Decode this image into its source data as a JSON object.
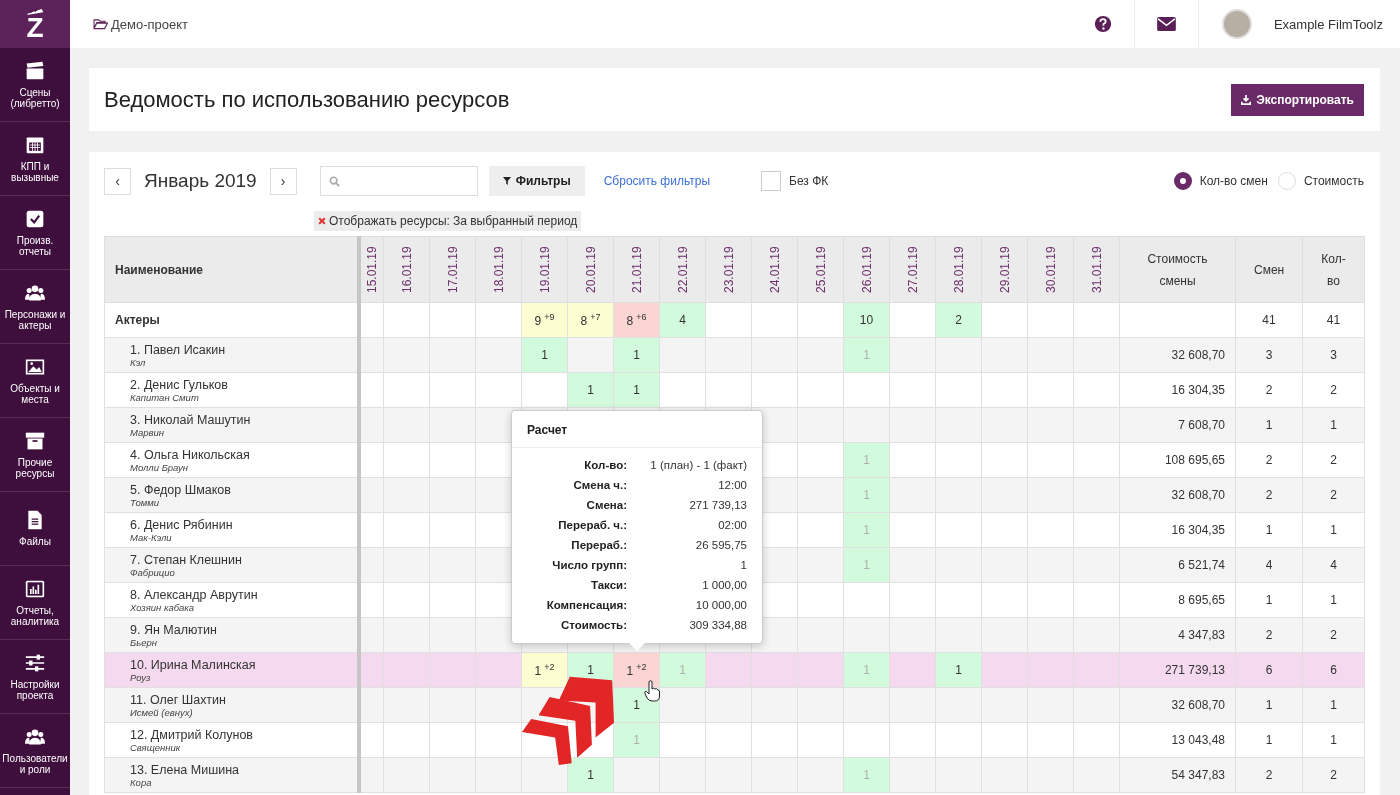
{
  "sidebar": {
    "logo": "Z",
    "items": [
      {
        "label": "Сцены (либретто)"
      },
      {
        "label": "КПП и вызывные"
      },
      {
        "label": "Произв. отчеты"
      },
      {
        "label": "Персонажи и актеры"
      },
      {
        "label": "Объекты и места"
      },
      {
        "label": "Прочие ресурсы"
      },
      {
        "label": "Файлы"
      },
      {
        "label": "Отчеты, аналитика"
      },
      {
        "label": "Настройки проекта"
      },
      {
        "label": "Пользователи и роли"
      }
    ]
  },
  "top_bar": {
    "project": "Демо-проект",
    "user": "Example FilmToolz"
  },
  "page": {
    "title": "Ведомость по использованию ресурсов",
    "export_button": "Экспортировать"
  },
  "toolbar": {
    "prev": "‹",
    "month": "Январь 2019",
    "next": "›",
    "filters_button": "Фильтры",
    "reset_link": "Сбросить фильтры",
    "without_fk": {
      "label": "Без ФК",
      "checked": false
    },
    "modes": [
      {
        "label": "Кол-во смен",
        "selected": true
      },
      {
        "label": "Стоимость",
        "selected": false
      }
    ],
    "active_filter": {
      "label": "Отображать ресурсы:",
      "value": "За выбранный период"
    }
  },
  "table": {
    "name_column": "Наименование",
    "dates": [
      "15.01.19",
      "16.01.19",
      "17.01.19",
      "18.01.19",
      "19.01.19",
      "20.01.19",
      "21.01.19",
      "22.01.19",
      "23.01.19",
      "24.01.19",
      "25.01.19",
      "26.01.19",
      "27.01.19",
      "28.01.19",
      "29.01.19",
      "30.01.19",
      "31.01.19"
    ],
    "cost_column": "Стоимость смены",
    "shifts_column": "Смен",
    "count_column": "Кол-во",
    "rows": [
      {
        "kind": "group",
        "name": "Актеры",
        "highlighted": false,
        "shifts": "41",
        "count": "41",
        "cells": [
          {},
          {},
          {},
          {},
          {
            "color": "#fdfdd2",
            "value": "9",
            "extra": "+9",
            "dim": false
          },
          {
            "color": "#fdfdd2",
            "value": "8",
            "extra": "+7",
            "dim": false
          },
          {
            "color": "#fbd4d4",
            "value": "8",
            "extra": "+6",
            "dim": false
          },
          {
            "color": "#d2fadc",
            "value": "4",
            "dim": false
          },
          {},
          {},
          {},
          {
            "color": "#d2fadc",
            "value": "10",
            "dim": false
          },
          {},
          {
            "color": "#d2fadc",
            "value": "2",
            "dim": false
          },
          {},
          {},
          {}
        ]
      },
      {
        "kind": "person",
        "name": "1. Павел Исакин",
        "role": "Кэл",
        "highlighted": false,
        "cost": "32 608,70",
        "shifts": "3",
        "count": "3",
        "cells": [
          {},
          {},
          {},
          {},
          {
            "color": "#d2fadc",
            "value": "1",
            "dim": false
          },
          {},
          {
            "color": "#d2fadc",
            "value": "1",
            "dim": false
          },
          {},
          {},
          {},
          {},
          {
            "color": "#d2fadc",
            "value": "1",
            "dim": true
          },
          {},
          {},
          {},
          {},
          {}
        ]
      },
      {
        "kind": "person",
        "name": "2. Денис Гульков",
        "role": "Капитан Смит",
        "highlighted": false,
        "cost": "16 304,35",
        "shifts": "2",
        "count": "2",
        "cells": [
          {},
          {},
          {},
          {},
          {},
          {
            "color": "#d2fadc",
            "value": "1",
            "dim": false
          },
          {
            "color": "#d2fadc",
            "value": "1",
            "dim": false
          },
          {},
          {},
          {},
          {},
          {},
          {},
          {},
          {},
          {},
          {}
        ]
      },
      {
        "kind": "person",
        "name": "3. Николай Машутин",
        "role": "Марвин",
        "highlighted": false,
        "cost": "7 608,70",
        "shifts": "1",
        "count": "1",
        "cells": [
          {},
          {},
          {},
          {},
          {},
          {},
          {},
          {},
          {},
          {},
          {},
          {},
          {},
          {},
          {},
          {},
          {}
        ]
      },
      {
        "kind": "person",
        "name": "4. Ольга Никольская",
        "role": "Молли Браун",
        "highlighted": false,
        "cost": "108 695,65",
        "shifts": "2",
        "count": "2",
        "cells": [
          {},
          {},
          {},
          {},
          {},
          {},
          {},
          {},
          {},
          {},
          {},
          {
            "color": "#d2fadc",
            "value": "1",
            "dim": true
          },
          {},
          {},
          {},
          {},
          {}
        ]
      },
      {
        "kind": "person",
        "name": "5. Федор Шмаков",
        "role": "Томми",
        "highlighted": false,
        "cost": "32 608,70",
        "shifts": "2",
        "count": "2",
        "cells": [
          {},
          {},
          {},
          {},
          {},
          {},
          {},
          {},
          {},
          {},
          {},
          {
            "color": "#d2fadc",
            "value": "1",
            "dim": true
          },
          {},
          {},
          {},
          {},
          {}
        ]
      },
      {
        "kind": "person",
        "name": "6. Денис Рябинин",
        "role": "Мак-Кэли",
        "highlighted": false,
        "cost": "16 304,35",
        "shifts": "1",
        "count": "1",
        "cells": [
          {},
          {},
          {},
          {},
          {},
          {},
          {},
          {},
          {},
          {},
          {},
          {
            "color": "#d2fadc",
            "value": "1",
            "dim": true
          },
          {},
          {},
          {},
          {},
          {}
        ]
      },
      {
        "kind": "person",
        "name": "7. Степан Клешнин",
        "role": "Фабрицио",
        "highlighted": false,
        "cost": "6 521,74",
        "shifts": "4",
        "count": "4",
        "cells": [
          {},
          {},
          {},
          {},
          {},
          {},
          {},
          {},
          {},
          {},
          {},
          {
            "color": "#d2fadc",
            "value": "1",
            "dim": true
          },
          {},
          {},
          {},
          {},
          {}
        ]
      },
      {
        "kind": "person",
        "name": "8. Александр Аврутин",
        "role": "Хозяин кабака",
        "highlighted": false,
        "cost": "8 695,65",
        "shifts": "1",
        "count": "1",
        "cells": [
          {},
          {},
          {},
          {},
          {},
          {},
          {},
          {},
          {},
          {},
          {},
          {},
          {},
          {},
          {},
          {},
          {}
        ]
      },
      {
        "kind": "person",
        "name": "9. Ян Малютин",
        "role": "Бьерн",
        "highlighted": false,
        "cost": "4 347,83",
        "shifts": "2",
        "count": "2",
        "cells": [
          {},
          {},
          {},
          {},
          {},
          {},
          {},
          {},
          {},
          {},
          {},
          {},
          {},
          {},
          {},
          {},
          {}
        ]
      },
      {
        "kind": "person",
        "name": "10. Ирина Малинская",
        "role": "Роуз",
        "highlighted": true,
        "cost": "271 739,13",
        "shifts": "6",
        "count": "6",
        "cells": [
          {},
          {},
          {},
          {},
          {
            "color": "#fdfdd2",
            "value": "1",
            "extra": "+2",
            "dim": false
          },
          {
            "color": "#d2fadc",
            "value": "1",
            "dim": false
          },
          {
            "color": "#fbd4d4",
            "value": "1",
            "extra": "+2",
            "dim": false,
            "hovered": true
          },
          {
            "color": "#d2fadc",
            "value": "1",
            "dim": true
          },
          {},
          {},
          {},
          {
            "color": "#d2fadc",
            "value": "1",
            "dim": true
          },
          {},
          {
            "color": "#d2fadc",
            "value": "1",
            "dim": false
          },
          {},
          {},
          {}
        ]
      },
      {
        "kind": "person",
        "name": "11. Олег Шахтин",
        "role": "Исмей (евнух)",
        "highlighted": false,
        "cost": "32 608,70",
        "shifts": "1",
        "count": "1",
        "cells": [
          {},
          {},
          {},
          {},
          {},
          {},
          {
            "color": "#d2fadc",
            "value": "1",
            "dim": false
          },
          {},
          {},
          {},
          {},
          {},
          {},
          {},
          {},
          {},
          {}
        ]
      },
      {
        "kind": "person",
        "name": "12. Дмитрий Колунов",
        "role": "Священник",
        "highlighted": false,
        "cost": "13 043,48",
        "shifts": "1",
        "count": "1",
        "cells": [
          {},
          {},
          {},
          {},
          {},
          {},
          {
            "color": "#d2fadc",
            "value": "1",
            "dim": true
          },
          {},
          {},
          {},
          {},
          {},
          {},
          {},
          {},
          {},
          {}
        ]
      },
      {
        "kind": "person",
        "name": "13. Елена Мишина",
        "role": "Кора",
        "highlighted": false,
        "cost": "54 347,83",
        "shifts": "2",
        "count": "2",
        "cells": [
          {},
          {},
          {},
          {},
          {},
          {
            "color": "#d2fadc",
            "value": "1",
            "dim": false
          },
          {},
          {},
          {},
          {},
          {},
          {
            "color": "#d2fadc",
            "value": "1",
            "dim": true
          },
          {},
          {},
          {},
          {},
          {}
        ]
      }
    ]
  },
  "tooltip": {
    "title": "Расчет",
    "rows": [
      {
        "label": "Кол-во:",
        "value": "1 (план) - 1 (факт)"
      },
      {
        "label": "Смена ч.:",
        "value": "12:00"
      },
      {
        "label": "Смена:",
        "value": "271 739,13"
      },
      {
        "label": "Перераб. ч.:",
        "value": "02:00"
      },
      {
        "label": "Перераб.:",
        "value": "26 595,75"
      },
      {
        "label": "Число групп:",
        "value": "1"
      },
      {
        "label": "Такси:",
        "value": "1 000,00"
      },
      {
        "label": "Компенсация:",
        "value": "10 000,00"
      },
      {
        "label": "Стоимость:",
        "value": "309 334,88"
      }
    ]
  }
}
